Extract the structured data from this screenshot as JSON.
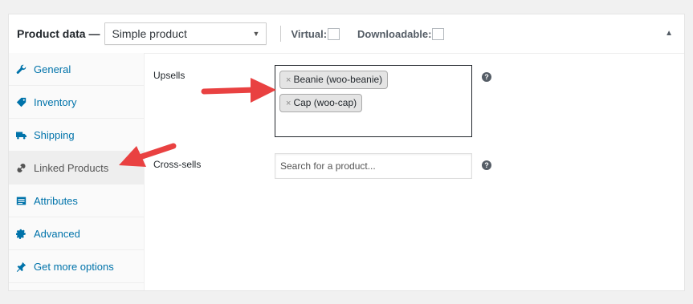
{
  "header": {
    "title": "Product data —",
    "product_type": "Simple product",
    "virtual_label": "Virtual:",
    "downloadable_label": "Downloadable:"
  },
  "tabs": [
    {
      "label": "General",
      "icon": "wrench-icon",
      "active": false
    },
    {
      "label": "Inventory",
      "icon": "tag-icon",
      "active": false
    },
    {
      "label": "Shipping",
      "icon": "truck-icon",
      "active": false
    },
    {
      "label": "Linked Products",
      "icon": "link-icon",
      "active": true
    },
    {
      "label": "Attributes",
      "icon": "list-icon",
      "active": false
    },
    {
      "label": "Advanced",
      "icon": "gear-icon",
      "active": false
    },
    {
      "label": "Get more options",
      "icon": "plugin-icon",
      "active": false
    }
  ],
  "linked_products": {
    "upsells_label": "Upsells",
    "upsells": [
      {
        "remove": "×",
        "label": "Beanie (woo-beanie)"
      },
      {
        "remove": "×",
        "label": "Cap (woo-cap)"
      }
    ],
    "crosssells_label": "Cross-sells",
    "crosssells_placeholder": "Search for a product...",
    "help_glyph": "?"
  },
  "colors": {
    "link": "#0073aa",
    "annotation_arrow": "#e94141",
    "active_tab_bg": "#eeeeee"
  }
}
